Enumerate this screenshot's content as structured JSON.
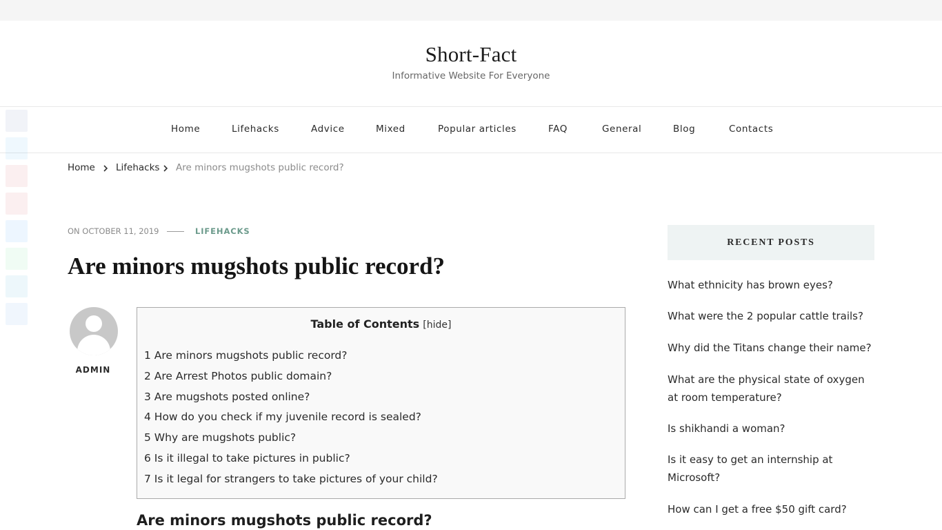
{
  "site": {
    "title": "Short-Fact",
    "tagline": "Informative Website For Everyone"
  },
  "nav": {
    "items": [
      {
        "label": "Home"
      },
      {
        "label": "Lifehacks"
      },
      {
        "label": "Advice"
      },
      {
        "label": "Mixed"
      },
      {
        "label": "Popular articles"
      },
      {
        "label": "FAQ"
      },
      {
        "label": "General"
      },
      {
        "label": "Blog"
      },
      {
        "label": "Contacts"
      }
    ]
  },
  "share_bar": {
    "icons": [
      "facebook-icon",
      "twitter-icon",
      "pinterest-icon",
      "pinterest-circle-icon",
      "messenger-icon",
      "whatsapp-icon",
      "telegram-icon",
      "share-icon"
    ],
    "colors": [
      "#3b5998",
      "#1da1f2",
      "#cb2027",
      "#cb2027",
      "#0084ff",
      "#25d366",
      "#0088cc",
      "#2a7de1"
    ]
  },
  "breadcrumb": {
    "home": "Home",
    "category": "Lifehacks",
    "current": "Are minors mugshots public record?"
  },
  "post": {
    "date": "ON OCTOBER 11, 2019",
    "category": "LIFEHACKS",
    "title": "Are minors mugshots public record?",
    "author": "ADMIN"
  },
  "toc": {
    "title": "Table of Contents",
    "toggle_open": "[",
    "toggle_label": "hide",
    "toggle_close": "]",
    "items": [
      "1 Are minors mugshots public record?",
      "2 Are Arrest Photos public domain?",
      "3 Are mugshots posted online?",
      "4 How do you check if my juvenile record is sealed?",
      "5 Why are mugshots public?",
      "6 Is it illegal to take pictures in public?",
      "7 Is it legal for strangers to take pictures of your child?"
    ]
  },
  "content": {
    "first_heading": "Are minors mugshots public record?"
  },
  "sidebar": {
    "widget_title": "RECENT POSTS",
    "recent_posts": [
      "What ethnicity has brown eyes?",
      "What were the 2 popular cattle trails?",
      "Why did the Titans change their name?",
      "What are the physical state of oxygen at room temperature?",
      "Is shikhandi a woman?",
      "Is it easy to get an internship at Microsoft?",
      "How can I get a free $50 gift card?"
    ]
  }
}
